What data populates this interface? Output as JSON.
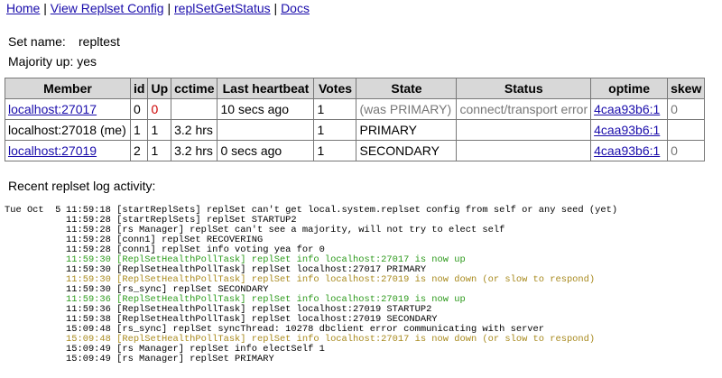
{
  "nav": {
    "home": "Home",
    "view_config": "View Replset Config",
    "get_status": "replSetGetStatus",
    "docs": "Docs",
    "separator": "|"
  },
  "summary": {
    "set_name_label": "Set name:",
    "set_name_value": "repltest",
    "majority_label": "Majority up:",
    "majority_value": "yes"
  },
  "table": {
    "headers": [
      "Member",
      "id",
      "Up",
      "cctime",
      "Last heartbeat",
      "Votes",
      "State",
      "Status",
      "optime",
      "skew"
    ],
    "rows": [
      {
        "member": "localhost:27017",
        "member_link": true,
        "id": "0",
        "up": "0",
        "cctime": "",
        "heartbeat": "10 secs ago",
        "votes": "1",
        "state": "(was PRIMARY)",
        "status": "connect/transport error",
        "optime": "4caa93b6:1",
        "skew": "0"
      },
      {
        "member": "localhost:27018 (me)",
        "member_link": false,
        "id": "1",
        "up": "1",
        "cctime": "3.2 hrs",
        "heartbeat": "",
        "votes": "1",
        "state": "PRIMARY",
        "status": "",
        "optime": "4caa93b6:1",
        "skew": ""
      },
      {
        "member": "localhost:27019",
        "member_link": true,
        "id": "2",
        "up": "1",
        "cctime": "3.2 hrs",
        "heartbeat": "0 secs ago",
        "votes": "1",
        "state": "SECONDARY",
        "status": "",
        "optime": "4caa93b6:1",
        "skew": "0"
      }
    ]
  },
  "log": {
    "title": "Recent replset log activity:",
    "colors": {
      "green": "#2d9a1c",
      "yellow": "#a88a1e"
    },
    "lines": [
      {
        "date": "Tue Oct  5",
        "text": "11:59:18 [startReplSets] replSet can't get local.system.replset config from self or any seed (yet)",
        "color": ""
      },
      {
        "date": "",
        "text": "11:59:28 [startReplSets] replSet STARTUP2",
        "color": ""
      },
      {
        "date": "",
        "text": "11:59:28 [rs Manager] replSet can't see a majority, will not try to elect self",
        "color": ""
      },
      {
        "date": "",
        "text": "11:59:28 [conn1] replSet RECOVERING",
        "color": ""
      },
      {
        "date": "",
        "text": "11:59:28 [conn1] replSet info voting yea for 0",
        "color": ""
      },
      {
        "date": "",
        "text": "11:59:30 [ReplSetHealthPollTask] replSet info localhost:27017 is now up",
        "color": "green"
      },
      {
        "date": "",
        "text": "11:59:30 [ReplSetHealthPollTask] replSet localhost:27017 PRIMARY",
        "color": ""
      },
      {
        "date": "",
        "text": "11:59:30 [ReplSetHealthPollTask] replSet info localhost:27019 is now down (or slow to respond)",
        "color": "yellow"
      },
      {
        "date": "",
        "text": "11:59:30 [rs_sync] replSet SECONDARY",
        "color": ""
      },
      {
        "date": "",
        "text": "11:59:36 [ReplSetHealthPollTask] replSet info localhost:27019 is now up",
        "color": "green"
      },
      {
        "date": "",
        "text": "11:59:36 [ReplSetHealthPollTask] replSet localhost:27019 STARTUP2",
        "color": ""
      },
      {
        "date": "",
        "text": "11:59:38 [ReplSetHealthPollTask] replSet localhost:27019 SECONDARY",
        "color": ""
      },
      {
        "date": "",
        "text": "15:09:48 [rs_sync] replSet syncThread: 10278 dbclient error communicating with server",
        "color": ""
      },
      {
        "date": "",
        "text": "15:09:48 [ReplSetHealthPollTask] replSet info localhost:27017 is now down (or slow to respond)",
        "color": "yellow"
      },
      {
        "date": "",
        "text": "15:09:49 [rs Manager] replSet info electSelf 1",
        "color": ""
      },
      {
        "date": "",
        "text": "15:09:49 [rs Manager] replSet PRIMARY",
        "color": ""
      }
    ]
  }
}
